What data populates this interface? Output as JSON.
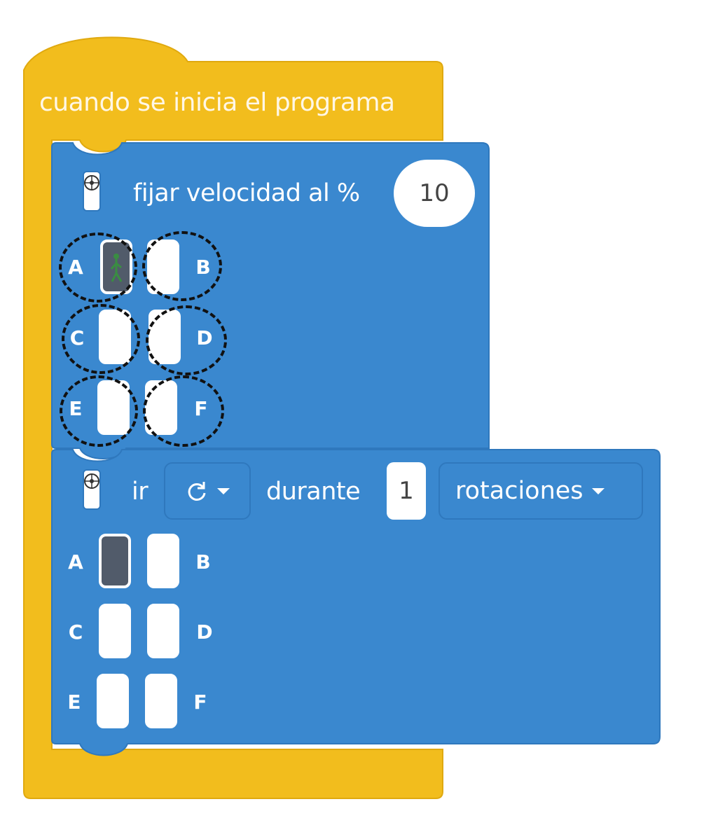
{
  "hat_block": {
    "label": "cuando se inicia el programa",
    "color": "#f2bd1d"
  },
  "speed_block": {
    "label": "fijar velocidad al %",
    "value": "10",
    "icon": "motor-icon",
    "color": "#3a88cf",
    "ports": [
      {
        "letter": "A",
        "selected": true
      },
      {
        "letter": "B",
        "selected": false
      },
      {
        "letter": "C",
        "selected": false
      },
      {
        "letter": "D",
        "selected": false
      },
      {
        "letter": "E",
        "selected": false
      },
      {
        "letter": "F",
        "selected": false
      }
    ]
  },
  "move_block": {
    "label_go": "ir",
    "direction_icon": "clockwise-arrow-icon",
    "label_during": "durante",
    "amount": "1",
    "unit": "rotaciones",
    "icon": "motor-icon",
    "ports": [
      {
        "letter": "A",
        "selected": true
      },
      {
        "letter": "B",
        "selected": false
      },
      {
        "letter": "C",
        "selected": false
      },
      {
        "letter": "D",
        "selected": false
      },
      {
        "letter": "E",
        "selected": false
      },
      {
        "letter": "F",
        "selected": false
      }
    ]
  }
}
